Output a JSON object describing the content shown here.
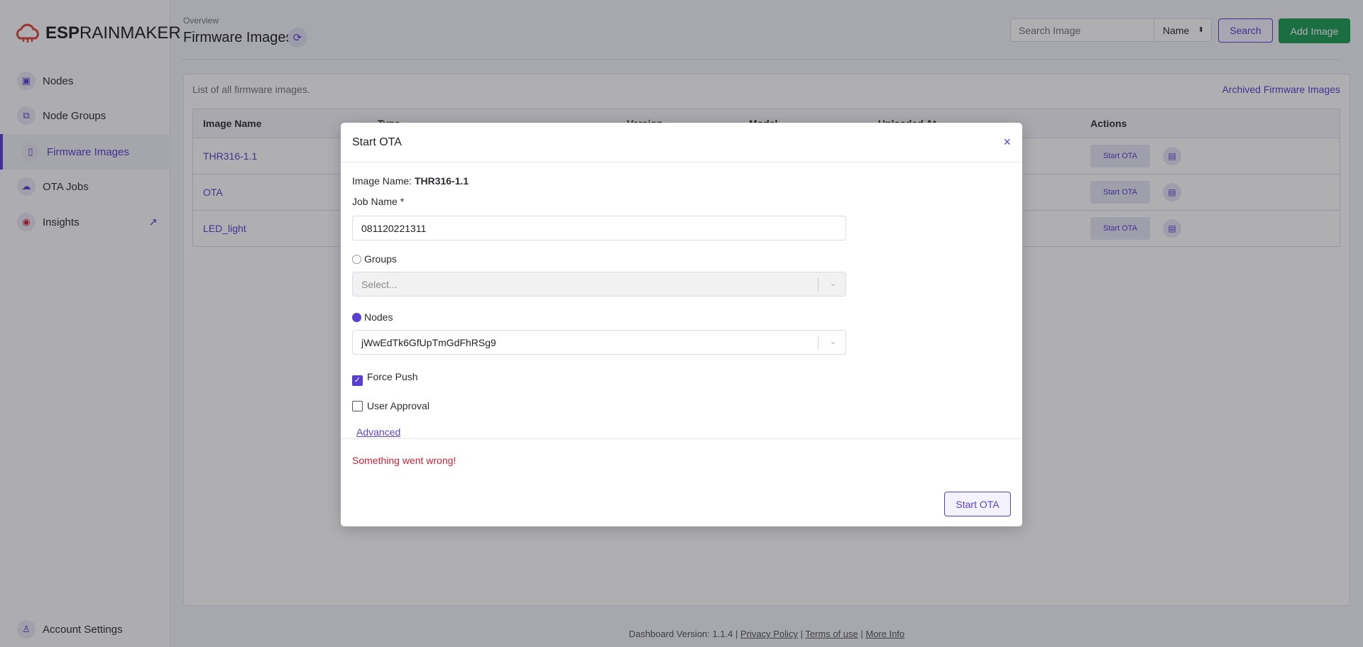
{
  "brand": {
    "logo_bold": "ESP",
    "logo_light": "RAINMAKER"
  },
  "sidebar": {
    "items": [
      {
        "label": "Nodes",
        "icon": "chip-icon"
      },
      {
        "label": "Node Groups",
        "icon": "group-icon"
      },
      {
        "label": "Firmware Images",
        "icon": "file-icon",
        "active": true
      },
      {
        "label": "OTA Jobs",
        "icon": "cloud-icon"
      },
      {
        "label": "Insights",
        "icon": "insights-icon",
        "external": true
      }
    ],
    "account": "Account Settings"
  },
  "header": {
    "breadcrumb": "Overview",
    "title": "Firmware Images",
    "search_placeholder": "Search Image",
    "search_by": "Name",
    "search_label": "Search",
    "add_label": "Add Image"
  },
  "card": {
    "description": "List of all firmware images.",
    "archived_link": "Archived Firmware Images"
  },
  "table": {
    "columns": [
      "Image Name",
      "Type",
      "Version",
      "Model",
      "Uploaded At",
      "Actions"
    ],
    "rows": [
      {
        "name": "THR316-1.1",
        "action": "Start OTA"
      },
      {
        "name": "OTA",
        "action": "Start OTA"
      },
      {
        "name": "LED_light",
        "action": "Start OTA"
      }
    ]
  },
  "footer": {
    "version": "Dashboard Version: 1.1.4 ",
    "privacy": "Privacy Policy",
    "terms": "Terms of use",
    "more": "More Info"
  },
  "modal": {
    "title": "Start OTA",
    "close": "×",
    "image_name_label": "Image Name: ",
    "image_name": "THR316-1.1",
    "job_name_label": "Job Name *",
    "job_name_value": "081120221311",
    "groups_label": "Groups",
    "groups_placeholder": "Select...",
    "nodes_label": "Nodes",
    "nodes_value": "jWwEdTk6GfUpTmGdFhRSg9",
    "force_push_label": "Force Push",
    "force_push": true,
    "user_approval_label": "User Approval",
    "user_approval": false,
    "advanced_label": "Advanced",
    "error": "Something went wrong!",
    "submit_label": "Start OTA",
    "selected_target": "Nodes"
  },
  "colors": {
    "accent": "#5b3fd1",
    "success": "#1f9d55",
    "error": "#d0223a"
  }
}
